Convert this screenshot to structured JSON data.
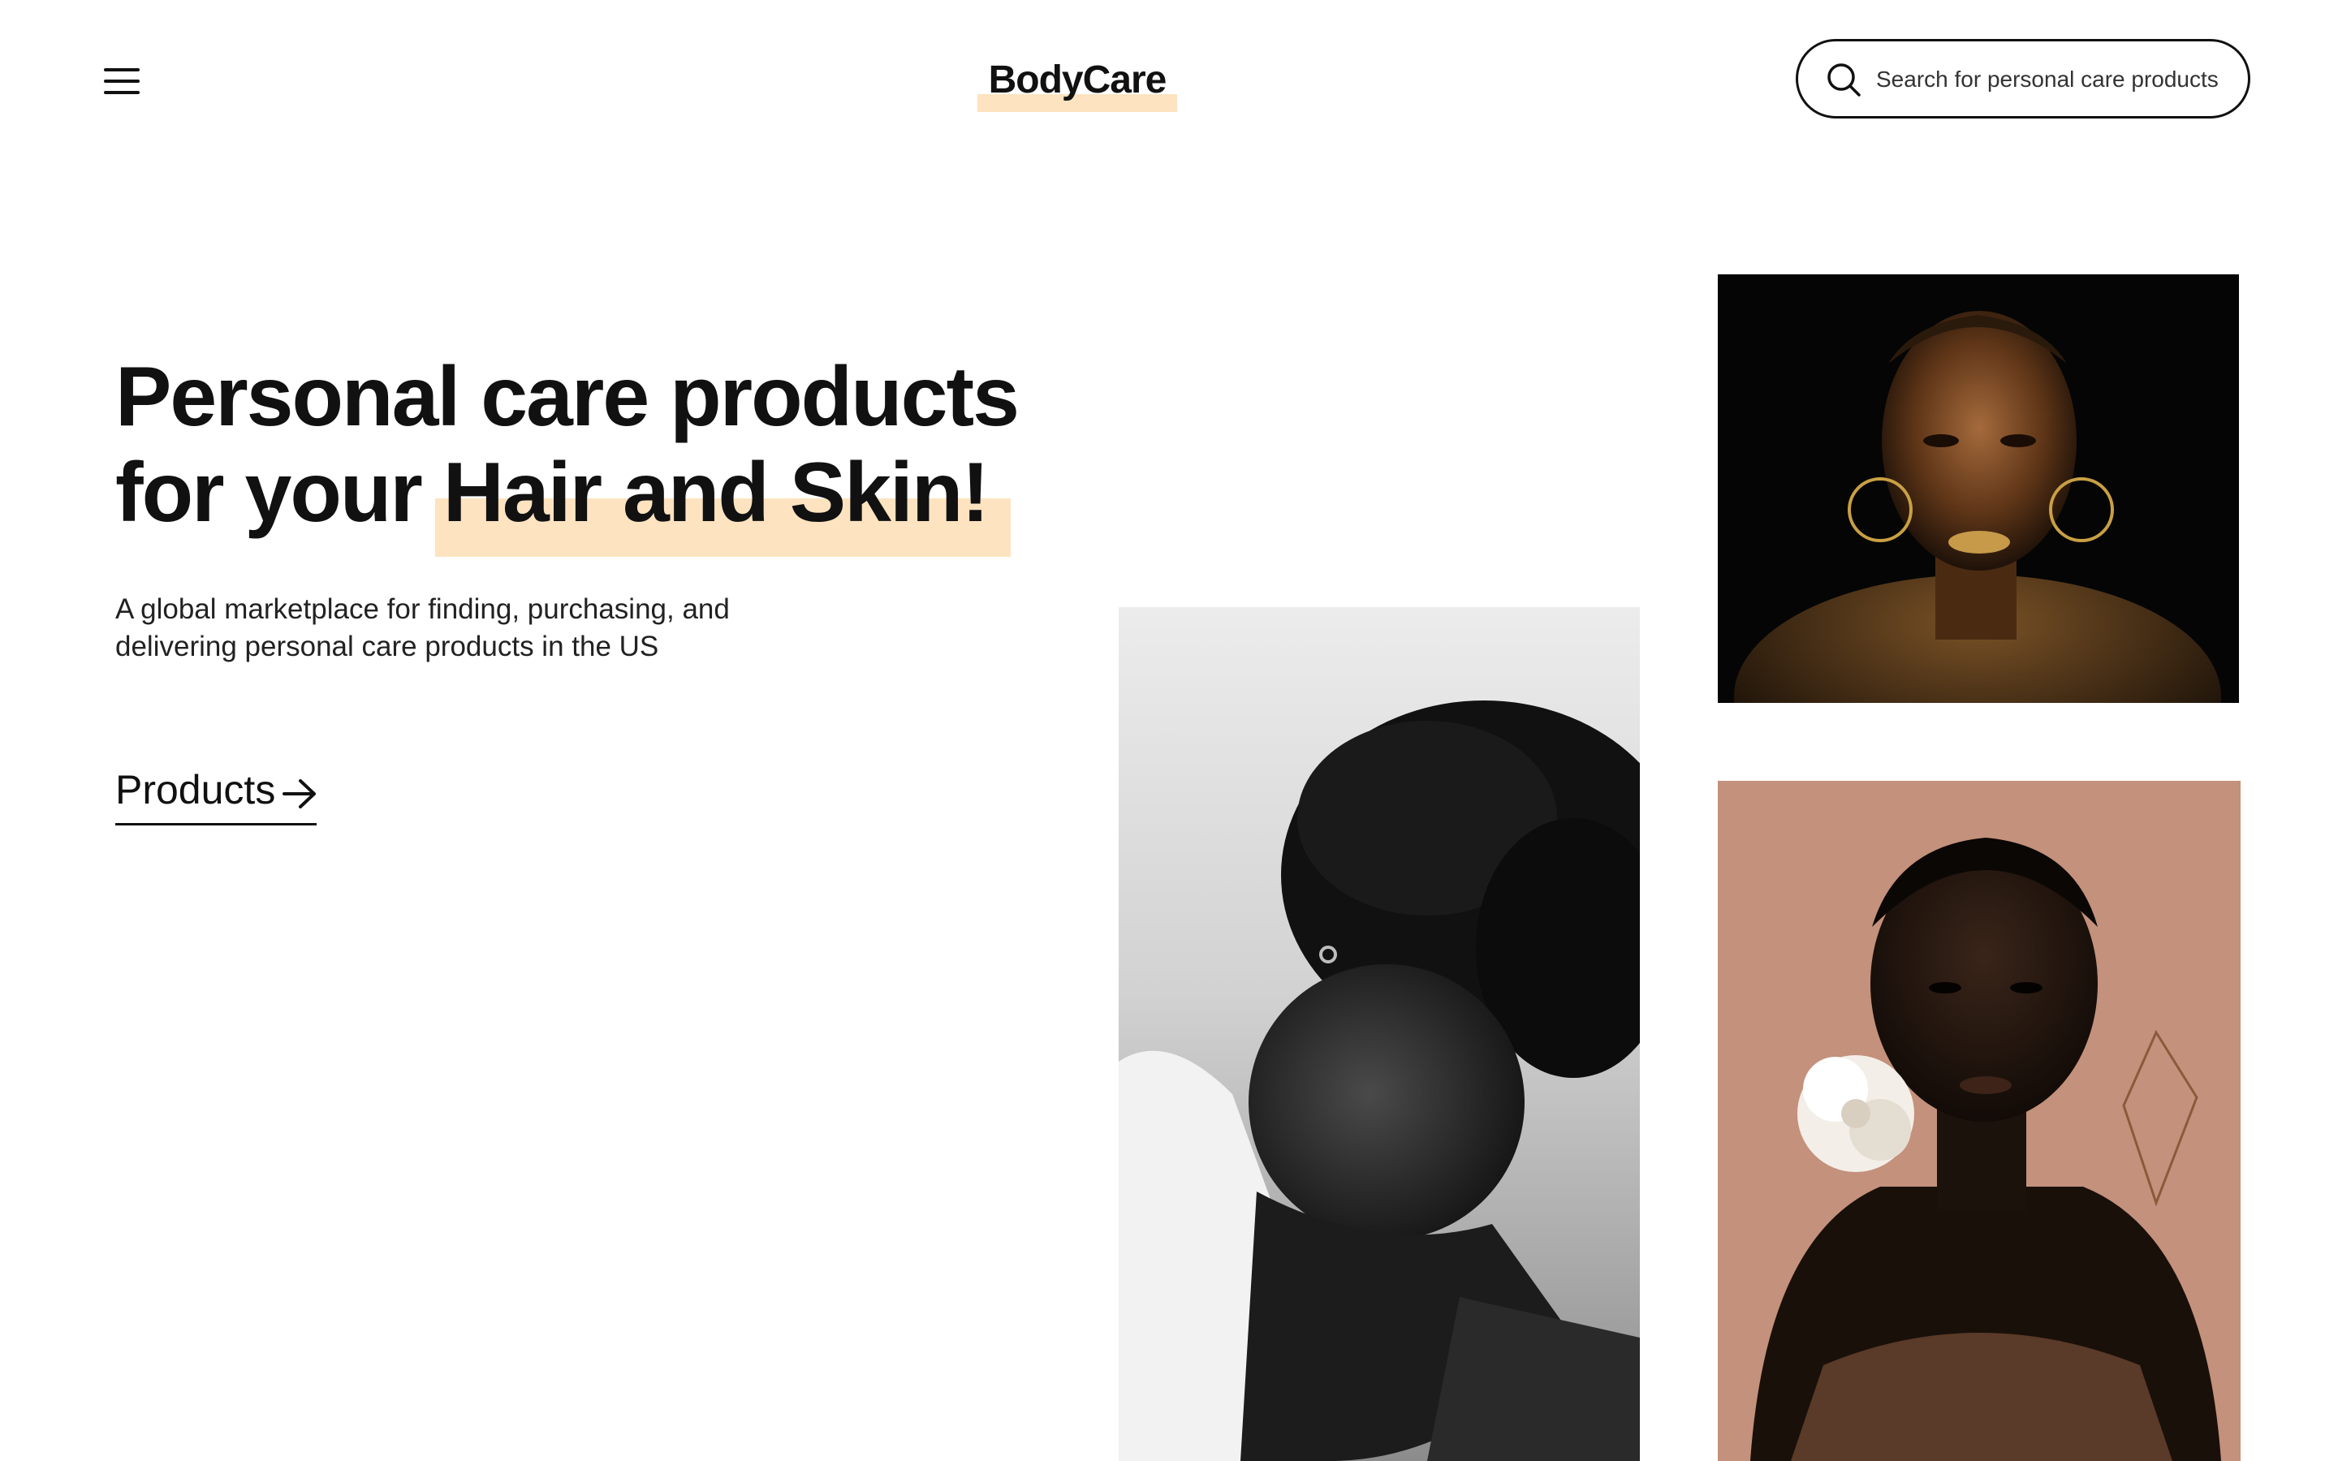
{
  "header": {
    "menu_icon": "hamburger-menu-icon",
    "logo": "BodyCare",
    "search": {
      "placeholder": "Search for personal care products",
      "value": "",
      "icon": "search-icon"
    }
  },
  "hero": {
    "headline_line1": "Personal care products",
    "headline_line2_prefix": "for your ",
    "headline_line2_highlight": "Hair and Skin!",
    "subtext": "A global marketplace for finding, purchasing, and delivering personal care products in the US",
    "cta_label": "Products",
    "cta_icon": "arrow-right-icon"
  },
  "images": [
    {
      "name": "photo-woman-black-and-white",
      "depicts": "woman-portrait-bw"
    },
    {
      "name": "photo-woman-gold-makeup",
      "depicts": "woman-portrait-gold"
    },
    {
      "name": "photo-woman-white-flower",
      "depicts": "woman-portrait-flower"
    }
  ],
  "colors": {
    "highlight": "#fde3c0",
    "text": "#111111",
    "background": "#ffffff"
  }
}
